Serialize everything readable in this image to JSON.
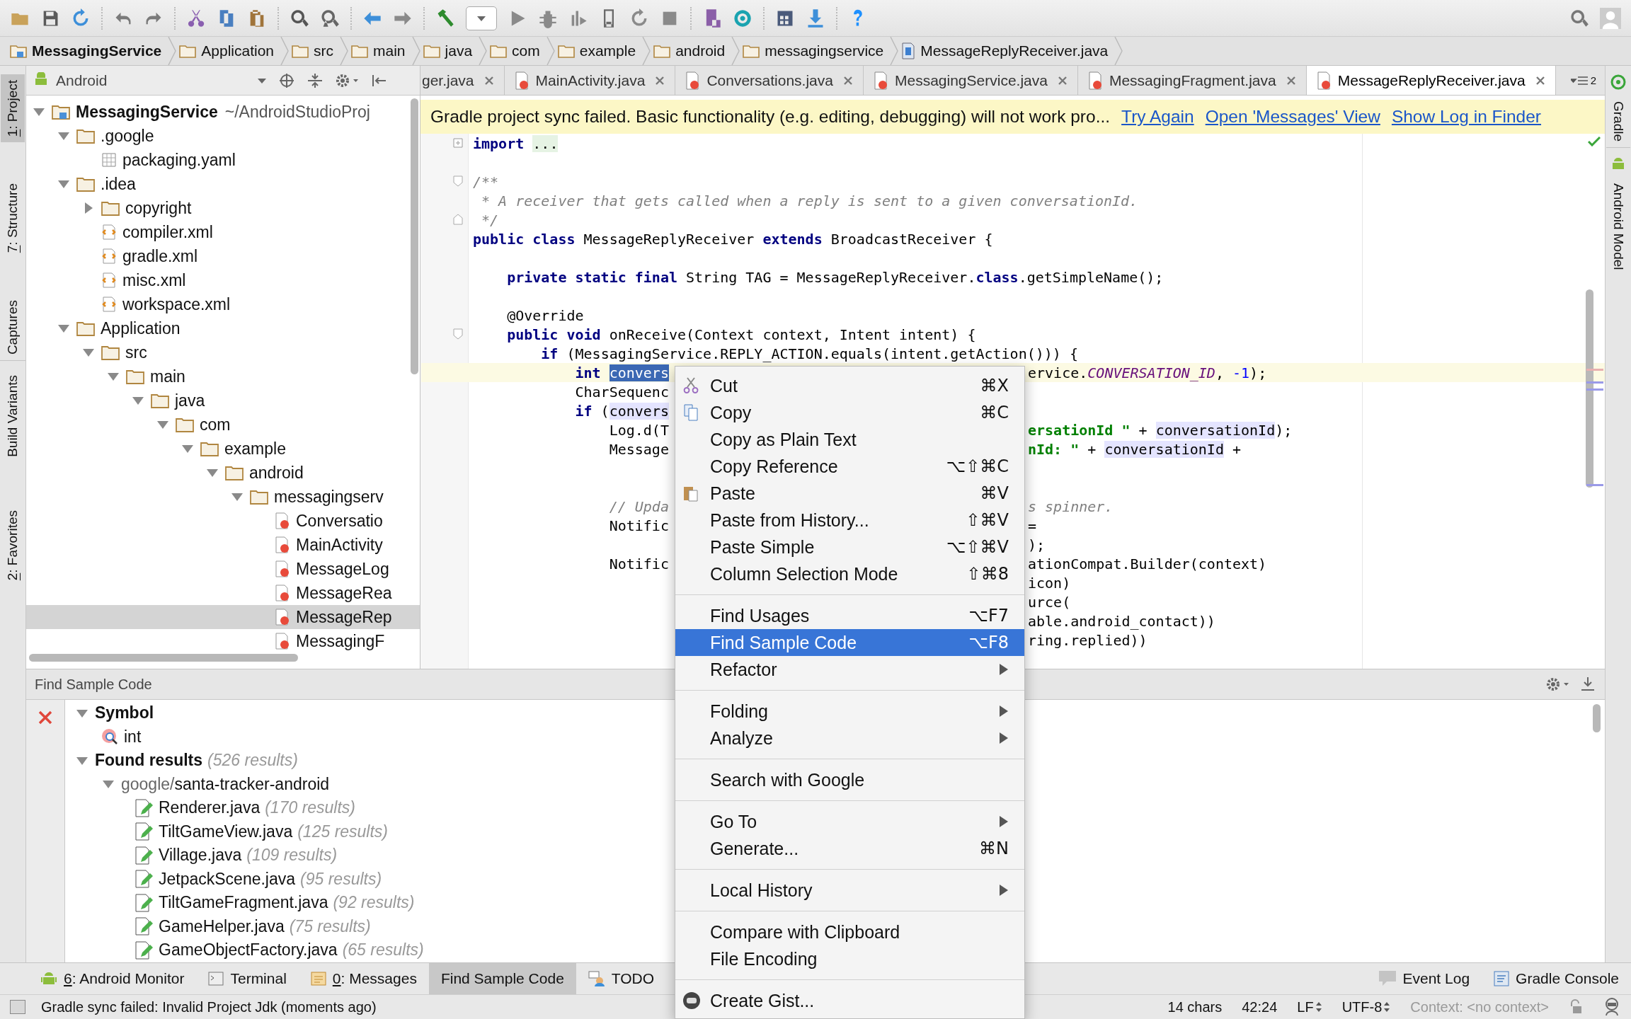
{
  "breadcrumbs": [
    {
      "label": "MessagingService",
      "kind": "module"
    },
    {
      "label": "Application",
      "kind": "folder"
    },
    {
      "label": "src",
      "kind": "folder"
    },
    {
      "label": "main",
      "kind": "folder"
    },
    {
      "label": "java",
      "kind": "folder"
    },
    {
      "label": "com",
      "kind": "folder"
    },
    {
      "label": "example",
      "kind": "folder"
    },
    {
      "label": "android",
      "kind": "folder"
    },
    {
      "label": "messagingservice",
      "kind": "folder"
    },
    {
      "label": "MessageReplyReceiver.java",
      "kind": "java"
    }
  ],
  "left_tool_strip": {
    "top": [
      {
        "mnemonic": "1",
        "label": ": Project",
        "selected": true
      },
      {
        "mnemonic": "7",
        "label": ": Structure",
        "selected": false
      },
      {
        "label": "Captures",
        "selected": false
      }
    ],
    "bottom": [
      {
        "label": "Build Variants",
        "selected": false
      },
      {
        "mnemonic": "2",
        "label": ": Favorites",
        "selected": false
      }
    ]
  },
  "right_tool_strip": {
    "top": [
      {
        "label": "Gradle"
      }
    ],
    "bottom": [
      {
        "label": "Android Model"
      }
    ]
  },
  "project_panel": {
    "view": "Android",
    "tree": [
      {
        "name": "MessagingService",
        "path": "~/AndroidStudioProj",
        "kind": "module",
        "expanded": true,
        "selected": false,
        "children": [
          {
            "name": ".google",
            "kind": "folder",
            "expanded": true,
            "selected": false,
            "children": [
              {
                "name": "packaging.yaml",
                "kind": "yaml",
                "selected": false
              }
            ]
          },
          {
            "name": ".idea",
            "kind": "folder",
            "expanded": true,
            "selected": false,
            "children": [
              {
                "name": "copyright",
                "kind": "folder",
                "expanded": false,
                "selected": false
              },
              {
                "name": "compiler.xml",
                "kind": "xml",
                "selected": false
              },
              {
                "name": "gradle.xml",
                "kind": "xml",
                "selected": false
              },
              {
                "name": "misc.xml",
                "kind": "xml",
                "selected": false
              },
              {
                "name": "workspace.xml",
                "kind": "xml",
                "selected": false
              }
            ]
          },
          {
            "name": "Application",
            "kind": "folder",
            "expanded": true,
            "selected": false,
            "children": [
              {
                "name": "src",
                "kind": "folder",
                "expanded": true,
                "selected": false,
                "children": [
                  {
                    "name": "main",
                    "kind": "folder",
                    "expanded": true,
                    "selected": false,
                    "children": [
                      {
                        "name": "java",
                        "kind": "folder",
                        "expanded": true,
                        "selected": false,
                        "children": [
                          {
                            "name": "com",
                            "kind": "folder",
                            "expanded": true,
                            "selected": false,
                            "children": [
                              {
                                "name": "example",
                                "kind": "folder",
                                "expanded": true,
                                "selected": false,
                                "children": [
                                  {
                                    "name": "android",
                                    "kind": "folder",
                                    "expanded": true,
                                    "selected": false,
                                    "children": [
                                      {
                                        "name": "messagingserv",
                                        "kind": "folder",
                                        "expanded": true,
                                        "selected": false,
                                        "children": [
                                          {
                                            "name": "Conversatio",
                                            "kind": "java",
                                            "selected": false
                                          },
                                          {
                                            "name": "MainActivity",
                                            "kind": "java",
                                            "selected": false
                                          },
                                          {
                                            "name": "MessageLog",
                                            "kind": "java",
                                            "selected": false
                                          },
                                          {
                                            "name": "MessageRea",
                                            "kind": "java",
                                            "selected": false
                                          },
                                          {
                                            "name": "MessageRep",
                                            "kind": "java",
                                            "selected": true
                                          },
                                          {
                                            "name": "MessagingF",
                                            "kind": "java",
                                            "selected": false
                                          }
                                        ]
                                      }
                                    ]
                                  }
                                ]
                              }
                            ]
                          }
                        ]
                      }
                    ]
                  }
                ]
              }
            ]
          }
        ]
      }
    ]
  },
  "editor_tabs": [
    {
      "label": "ger.java",
      "selected": false
    },
    {
      "label": "MainActivity.java",
      "selected": false
    },
    {
      "label": "Conversations.java",
      "selected": false
    },
    {
      "label": "MessagingService.java",
      "selected": false
    },
    {
      "label": "MessagingFragment.java",
      "selected": false
    },
    {
      "label": "MessageReplyReceiver.java",
      "selected": true
    }
  ],
  "hidden_tabs_count": "2",
  "banner": {
    "text": "Gradle project sync failed. Basic functionality (e.g. editing, debugging) will not work pro...",
    "links": [
      "Try Again",
      "Open 'Messages' View",
      "Show Log in Finder"
    ]
  },
  "code_lines": [
    {
      "kind": "code",
      "current": false,
      "folded": true,
      "segments": [
        {
          "t": "import ",
          "kind": "keyword"
        },
        {
          "t": "...",
          "kind": "folded"
        }
      ]
    },
    {
      "kind": "blank",
      "current": false
    },
    {
      "kind": "code",
      "current": false,
      "fold_start": true,
      "segments": [
        {
          "t": "/**",
          "kind": "comment"
        }
      ]
    },
    {
      "kind": "code",
      "current": false,
      "segments": [
        {
          "t": " * A receiver that gets called when a reply is sent to a given conversationId.",
          "kind": "comment"
        }
      ]
    },
    {
      "kind": "code",
      "current": false,
      "fold_end": true,
      "segments": [
        {
          "t": " */",
          "kind": "comment"
        }
      ]
    },
    {
      "kind": "code",
      "current": false,
      "segments": [
        {
          "t": "public class",
          "kind": "keyword"
        },
        {
          "t": " MessageReplyReceiver ",
          "kind": "plain"
        },
        {
          "t": "extends",
          "kind": "keyword"
        },
        {
          "t": " BroadcastReceiver {",
          "kind": "plain"
        }
      ]
    },
    {
      "kind": "blank",
      "current": false
    },
    {
      "kind": "code",
      "current": false,
      "segments": [
        {
          "t": "    private static final",
          "kind": "keyword"
        },
        {
          "t": " String TAG = MessageReplyReceiver.",
          "kind": "plain"
        },
        {
          "t": "class",
          "kind": "keyword"
        },
        {
          "t": ".getSimpleName();",
          "kind": "plain"
        }
      ]
    },
    {
      "kind": "blank",
      "current": false
    },
    {
      "kind": "code",
      "current": false,
      "segments": [
        {
          "t": "    @Override",
          "kind": "plain"
        }
      ]
    },
    {
      "kind": "code",
      "current": false,
      "fold_start": true,
      "segments": [
        {
          "t": "    public void",
          "kind": "keyword"
        },
        {
          "t": " onReceive(Context context, Intent intent) {",
          "kind": "plain"
        }
      ]
    },
    {
      "kind": "code",
      "current": false,
      "segments": [
        {
          "t": "        if",
          "kind": "keyword"
        },
        {
          "t": " (MessagingService.REPLY_ACTION.equals(intent.getAction())) {",
          "kind": "plain"
        }
      ]
    },
    {
      "kind": "code",
      "current": true,
      "segments": [
        {
          "t": "            int ",
          "kind": "keyword"
        },
        {
          "t": "convers",
          "kind": "selected"
        }
      ],
      "after_menu": [
        {
          "t": "ervice.",
          "kind": "plain"
        },
        {
          "t": "CONVERSATION_ID",
          "kind": "field"
        },
        {
          "t": ", ",
          "kind": "plain"
        },
        {
          "t": "-1",
          "kind": "number"
        },
        {
          "t": ");",
          "kind": "plain"
        }
      ]
    },
    {
      "kind": "code",
      "current": false,
      "segments": [
        {
          "t": "            CharSequenc",
          "kind": "plain"
        }
      ]
    },
    {
      "kind": "code",
      "current": false,
      "segments": [
        {
          "t": "            if",
          "kind": "keyword"
        },
        {
          "t": " (",
          "kind": "plain"
        },
        {
          "t": "convers",
          "kind": "highlight"
        }
      ]
    },
    {
      "kind": "code",
      "current": false,
      "segments": [
        {
          "t": "                Log.d(T",
          "kind": "plain"
        }
      ],
      "after_menu": [
        {
          "t": "ersationId \"",
          "kind": "string"
        },
        {
          "t": " + ",
          "kind": "plain"
        },
        {
          "t": "conversationId",
          "kind": "highlight"
        },
        {
          "t": ");",
          "kind": "plain"
        }
      ]
    },
    {
      "kind": "code",
      "current": false,
      "segments": [
        {
          "t": "                Message",
          "kind": "plain"
        }
      ],
      "after_menu": [
        {
          "t": "nId: \"",
          "kind": "string"
        },
        {
          "t": " + ",
          "kind": "plain"
        },
        {
          "t": "conversationId",
          "kind": "highlight"
        },
        {
          "t": " +",
          "kind": "plain"
        }
      ]
    },
    {
      "kind": "blank",
      "current": false
    },
    {
      "kind": "blank",
      "current": false
    },
    {
      "kind": "code",
      "current": false,
      "segments": [
        {
          "t": "                // Upda",
          "kind": "comment"
        }
      ],
      "after_menu": [
        {
          "t": "s spinner.",
          "kind": "comment"
        }
      ]
    },
    {
      "kind": "code",
      "current": false,
      "segments": [
        {
          "t": "                Notific",
          "kind": "plain"
        }
      ],
      "after_menu": [
        {
          "t": "=",
          "kind": "plain"
        }
      ]
    },
    {
      "kind": "code",
      "current": false,
      "after_menu": [
        {
          "t": ");",
          "kind": "plain"
        }
      ]
    },
    {
      "kind": "code",
      "current": false,
      "segments": [
        {
          "t": "                Notific",
          "kind": "plain"
        }
      ],
      "after_menu": [
        {
          "t": "ationCompat.Builder(context)",
          "kind": "plain"
        }
      ]
    },
    {
      "kind": "code",
      "current": false,
      "after_menu": [
        {
          "t": "icon)",
          "kind": "plain"
        }
      ]
    },
    {
      "kind": "code",
      "current": false,
      "after_menu": [
        {
          "t": "urce(",
          "kind": "plain"
        }
      ]
    },
    {
      "kind": "code",
      "current": false,
      "after_menu": [
        {
          "t": "able.android_contact))",
          "kind": "plain"
        }
      ]
    },
    {
      "kind": "code",
      "current": false,
      "after_menu": [
        {
          "t": "ring.replied))",
          "kind": "plain"
        }
      ]
    }
  ],
  "find_panel": {
    "title": "Find Sample Code",
    "results": [
      {
        "label": "Symbol",
        "kind": "group",
        "expanded": true,
        "children": [
          {
            "label": "int",
            "kind": "symbol"
          }
        ]
      },
      {
        "label": "Found results",
        "count": "(526 results)",
        "kind": "group",
        "expanded": true,
        "children": [
          {
            "owner": "google/",
            "label": "santa-tracker-android",
            "kind": "repo",
            "expanded": true,
            "children": [
              {
                "label": "Renderer.java",
                "count": "(170 results)",
                "kind": "file"
              },
              {
                "label": "TiltGameView.java",
                "count": "(125 results)",
                "kind": "file"
              },
              {
                "label": "Village.java",
                "count": "(109 results)",
                "kind": "file"
              },
              {
                "label": "JetpackScene.java",
                "count": "(95 results)",
                "kind": "file"
              },
              {
                "label": "TiltGameFragment.java",
                "count": "(92 results)",
                "kind": "file"
              },
              {
                "label": "GameHelper.java",
                "count": "(75 results)",
                "kind": "file"
              },
              {
                "label": "GameObjectFactory.java",
                "count": "(65 results)",
                "kind": "file"
              }
            ]
          }
        ]
      }
    ]
  },
  "tool_windows": [
    {
      "mnemonic": "6",
      "label": ": Android Monitor",
      "kind": "android",
      "selected": false
    },
    {
      "label": "Terminal",
      "kind": "terminal",
      "selected": false
    },
    {
      "mnemonic": "0",
      "label": ": Messages",
      "kind": "messages",
      "selected": false
    },
    {
      "label": "Find Sample Code",
      "kind": "none",
      "selected": true
    },
    {
      "label": "TODO",
      "kind": "todo",
      "selected": false
    }
  ],
  "tool_windows_right": [
    {
      "label": "Event Log",
      "kind": "event"
    },
    {
      "label": "Gradle Console",
      "kind": "console"
    }
  ],
  "context_menu": [
    {
      "kind": "item",
      "label": "Cut",
      "shortcut": "⌘X",
      "selected": false,
      "submenu": false
    },
    {
      "kind": "item",
      "label": "Copy",
      "shortcut": "⌘C",
      "selected": false,
      "submenu": false
    },
    {
      "kind": "item",
      "label": "Copy as Plain Text",
      "selected": false,
      "submenu": false
    },
    {
      "kind": "item",
      "label": "Copy Reference",
      "shortcut": "⌥⇧⌘C",
      "selected": false,
      "submenu": false
    },
    {
      "kind": "item",
      "label": "Paste",
      "shortcut": "⌘V",
      "selected": false,
      "submenu": false
    },
    {
      "kind": "item",
      "label": "Paste from History...",
      "shortcut": "⇧⌘V",
      "selected": false,
      "submenu": false
    },
    {
      "kind": "item",
      "label": "Paste Simple",
      "shortcut": "⌥⇧⌘V",
      "selected": false,
      "submenu": false
    },
    {
      "kind": "item",
      "label": "Column Selection Mode",
      "shortcut": "⇧⌘8",
      "selected": false,
      "submenu": false
    },
    {
      "kind": "separator"
    },
    {
      "kind": "item",
      "label": "Find Usages",
      "shortcut": "⌥F7",
      "selected": false,
      "submenu": false
    },
    {
      "kind": "item",
      "label": "Find Sample Code",
      "shortcut": "⌥F8",
      "selected": true,
      "submenu": false
    },
    {
      "kind": "item",
      "label": "Refactor",
      "selected": false,
      "submenu": true
    },
    {
      "kind": "separator"
    },
    {
      "kind": "item",
      "label": "Folding",
      "selected": false,
      "submenu": true
    },
    {
      "kind": "item",
      "label": "Analyze",
      "selected": false,
      "submenu": true
    },
    {
      "kind": "separator"
    },
    {
      "kind": "item",
      "label": "Search with Google",
      "selected": false,
      "submenu": false
    },
    {
      "kind": "separator"
    },
    {
      "kind": "item",
      "label": "Go To",
      "selected": false,
      "submenu": true
    },
    {
      "kind": "item",
      "label": "Generate...",
      "shortcut": "⌘N",
      "selected": false,
      "submenu": false
    },
    {
      "kind": "separator"
    },
    {
      "kind": "item",
      "label": "Local History",
      "selected": false,
      "submenu": true
    },
    {
      "kind": "separator"
    },
    {
      "kind": "item",
      "label": "Compare with Clipboard",
      "selected": false,
      "submenu": false
    },
    {
      "kind": "item",
      "label": "File Encoding",
      "selected": false,
      "submenu": false
    },
    {
      "kind": "separator"
    },
    {
      "kind": "item",
      "label": "Create Gist...",
      "selected": false,
      "submenu": false
    }
  ],
  "status_bar": {
    "message": "Gradle sync failed: Invalid Project Jdk (moments ago)",
    "chars": "14 chars",
    "position": "42:24",
    "line_separator": "LF",
    "encoding": "UTF-8",
    "context": "Context: <no context>"
  }
}
